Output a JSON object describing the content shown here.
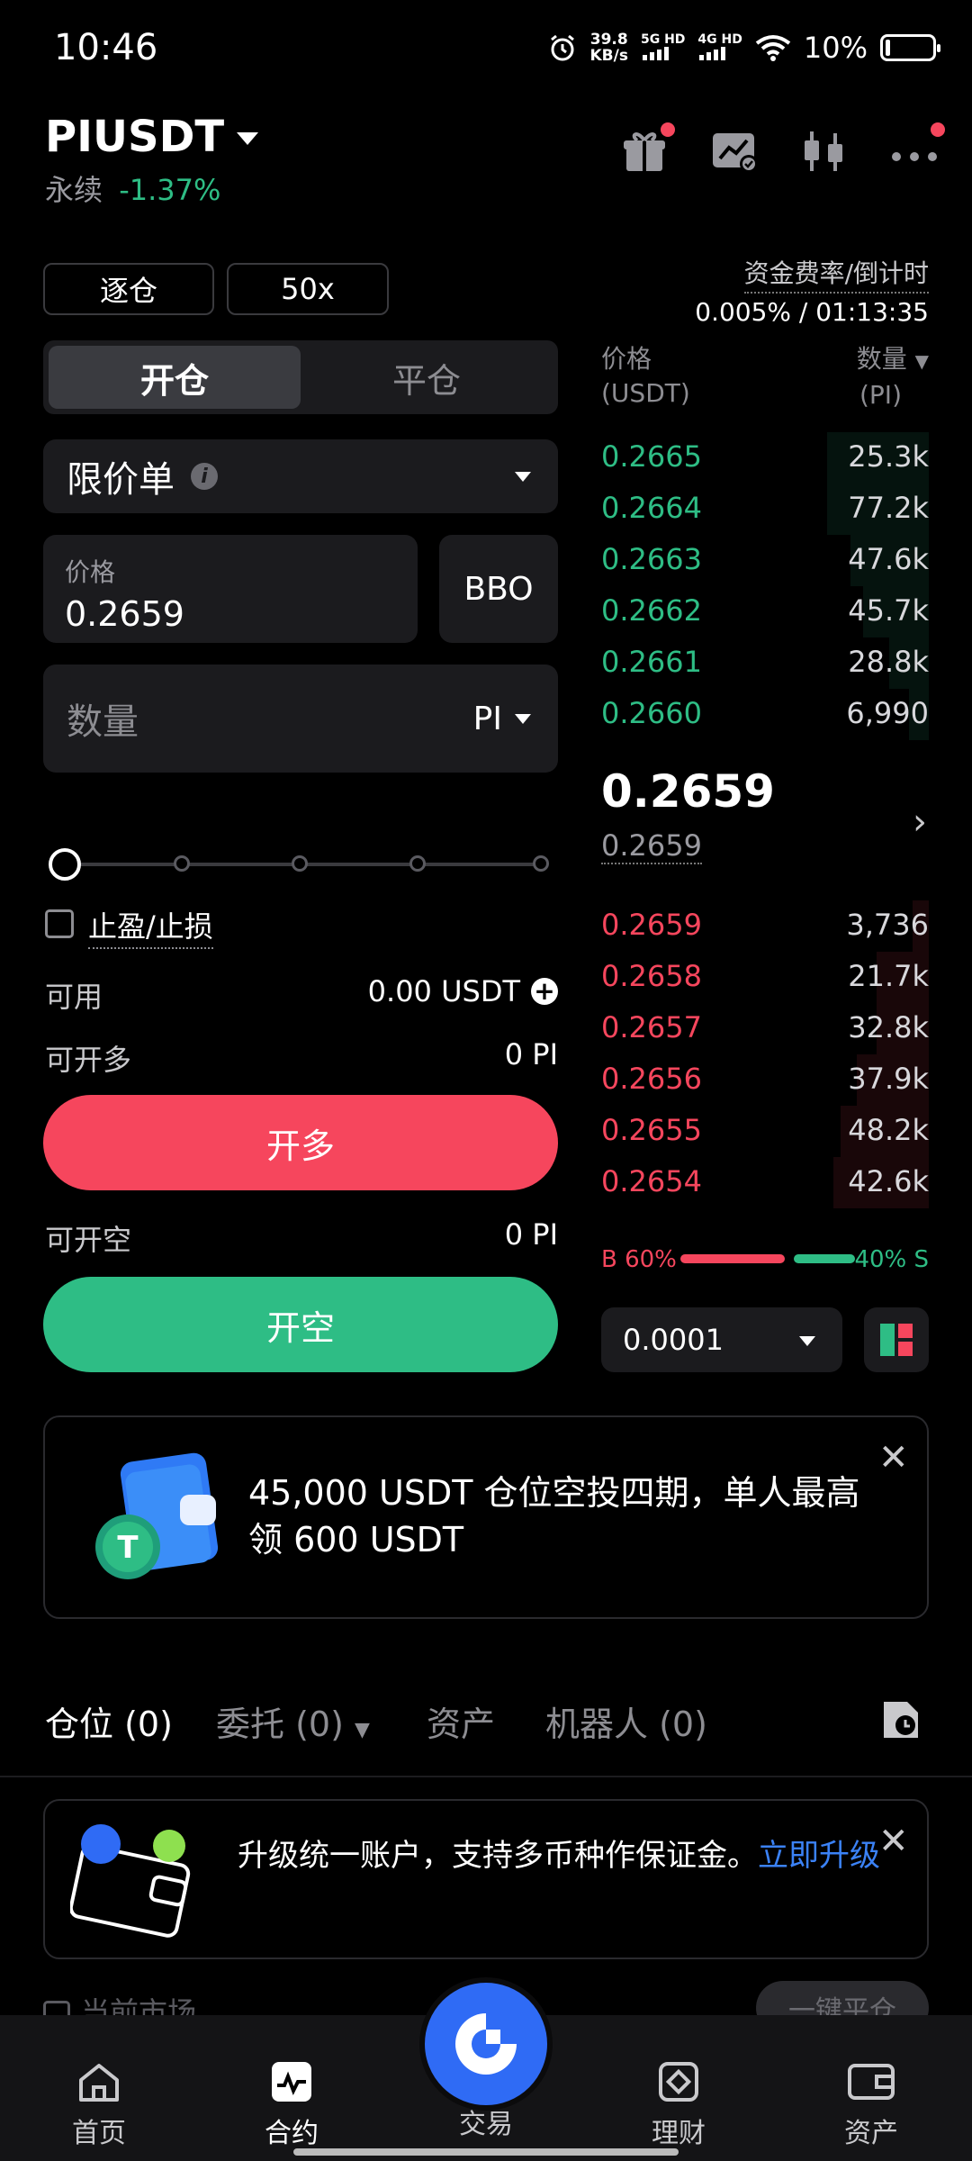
{
  "status_bar": {
    "time": "10:46",
    "net_speed_value": "39.8",
    "net_speed_unit": "KB/s",
    "sim1": "5G HD",
    "sim2": "4G HD",
    "battery": "10%"
  },
  "header": {
    "pair": "PIUSDT",
    "contract_type": "永续",
    "change": "-1.37%"
  },
  "controls": {
    "margin_mode": "逐仓",
    "leverage": "50x",
    "funding_label": "资金费率/倒计时",
    "funding_value": "0.005% / 01:13:35"
  },
  "order_tabs": {
    "open": "开仓",
    "close": "平仓"
  },
  "order_type": "限价单",
  "price": {
    "label": "价格",
    "value": "0.2659",
    "bbo": "BBO"
  },
  "quantity": {
    "placeholder": "数量",
    "unit": "PI"
  },
  "tpsl_label": "止盈/止损",
  "available": {
    "label": "可用",
    "value": "0.00 USDT"
  },
  "can_long": {
    "label": "可开多",
    "value": "0 PI"
  },
  "long_button": "开多",
  "can_short": {
    "label": "可开空",
    "value": "0 PI"
  },
  "short_button": "开空",
  "order_book": {
    "price_header": "价格",
    "price_unit": "(USDT)",
    "qty_header": "数量",
    "qty_unit": "(PI)",
    "asks": [
      {
        "price": "0.2665",
        "qty": "25.3k",
        "depth": 0.31
      },
      {
        "price": "0.2664",
        "qty": "77.2k",
        "depth": 0.31
      },
      {
        "price": "0.2663",
        "qty": "47.6k",
        "depth": 0.24
      },
      {
        "price": "0.2662",
        "qty": "45.7k",
        "depth": 0.2
      },
      {
        "price": "0.2661",
        "qty": "28.8k",
        "depth": 0.12
      },
      {
        "price": "0.2660",
        "qty": "6,990",
        "depth": 0.06
      }
    ],
    "last_price": "0.2659",
    "mark_price": "0.2659",
    "bids": [
      {
        "price": "0.2659",
        "qty": "3,736",
        "depth": 0.05
      },
      {
        "price": "0.2658",
        "qty": "21.7k",
        "depth": 0.16
      },
      {
        "price": "0.2657",
        "qty": "32.8k",
        "depth": 0.16
      },
      {
        "price": "0.2656",
        "qty": "37.9k",
        "depth": 0.22
      },
      {
        "price": "0.2655",
        "qty": "48.2k",
        "depth": 0.27
      },
      {
        "price": "0.2654",
        "qty": "42.6k",
        "depth": 0.29
      }
    ],
    "buy_ratio": "B 60%",
    "sell_ratio": "40% S",
    "buy_fraction": 0.6,
    "precision": "0.0001"
  },
  "promo_banner": {
    "text": "45,000 USDT 仓位空投四期，单人最高领 600 USDT"
  },
  "position_tabs": [
    "仓位 (0)",
    "委托 (0)",
    "资产",
    "机器人 (0)"
  ],
  "upgrade_banner": {
    "text": "升级统一账户，支持多币种作保证金。",
    "link": "立即升级"
  },
  "partial": {
    "current_market": "当前市场",
    "close_all": "一键平仓"
  },
  "nav": [
    "首页",
    "合约",
    "交易",
    "理财",
    "资产"
  ],
  "colors": {
    "green": "#2ebd85",
    "red": "#f6465d",
    "blue": "#2f6bf5"
  }
}
